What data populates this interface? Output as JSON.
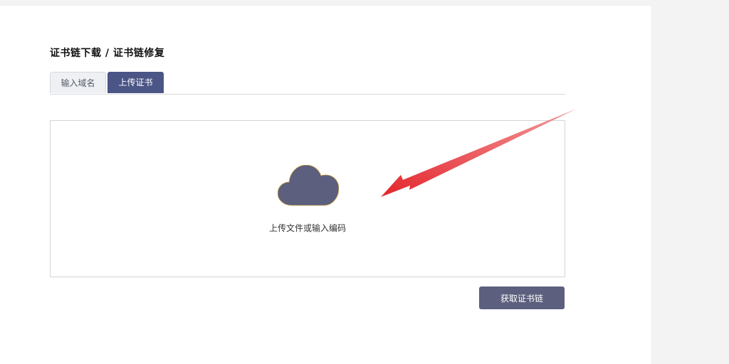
{
  "page": {
    "title": "证书链下载 / 证书链修复"
  },
  "tabs": [
    {
      "label": "输入域名",
      "active": false
    },
    {
      "label": "上传证书",
      "active": true
    }
  ],
  "upload": {
    "icon": "cloud-icon",
    "text": "上传文件或输入编码"
  },
  "actions": {
    "submit_label": "获取证书链"
  },
  "colors": {
    "accent": "#4b5586",
    "cloud": "#5c5f7d",
    "button": "#5c5f7d",
    "annotation_arrow": "#e8383d"
  }
}
